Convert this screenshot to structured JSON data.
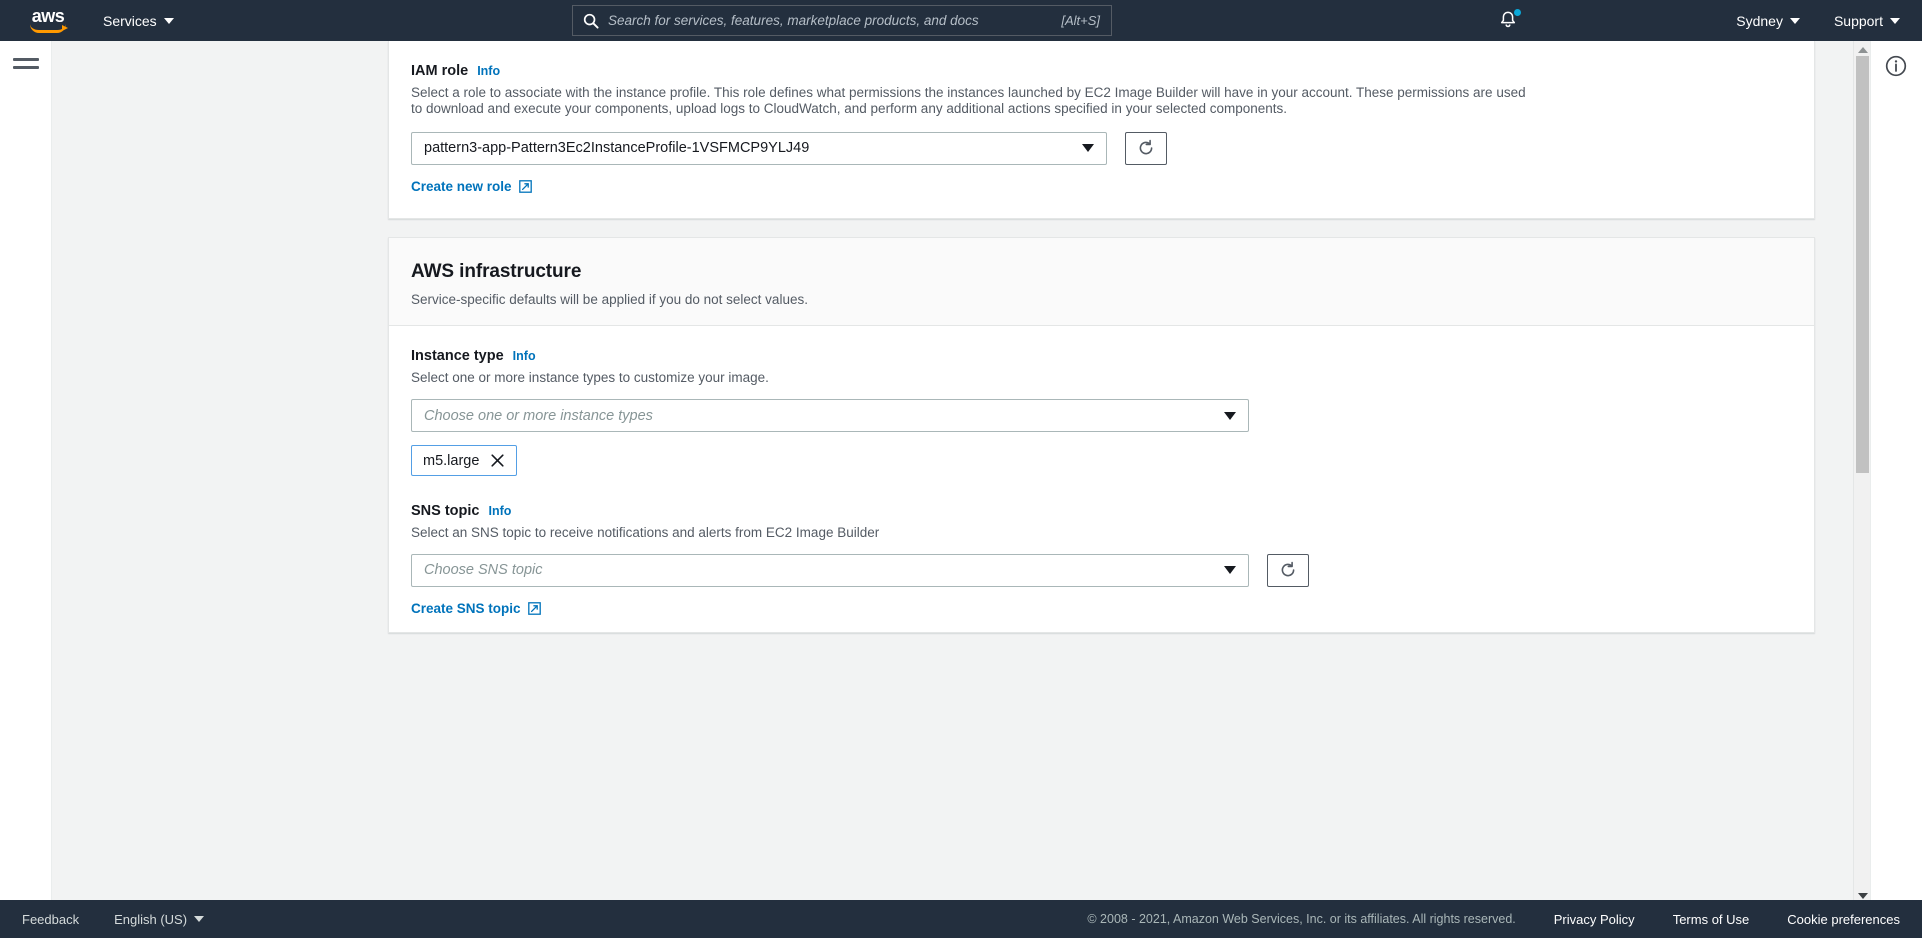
{
  "topnav": {
    "logo_text": "aws",
    "services_label": "Services",
    "search": {
      "placeholder": "Search for services, features, marketplace products, and docs",
      "value": "",
      "shortcut": "[Alt+S]"
    },
    "region_label": "Sydney",
    "support_label": "Support"
  },
  "cards": {
    "iam": {
      "label": "IAM role",
      "info_label": "Info",
      "description": "Select a role to associate with the instance profile. This role defines what permissions the instances launched by EC2 Image Builder will have in your account. These permissions are used to download and execute your components, upload logs to CloudWatch, and perform any additional actions specified in your selected components.",
      "selected_role": "pattern3-app-Pattern3Ec2InstanceProfile-1VSFMCP9YLJ49",
      "create_link": "Create new role"
    },
    "infrastructure": {
      "title": "AWS infrastructure",
      "subtitle": "Service-specific defaults will be applied if you do not select values.",
      "instance_type": {
        "label": "Instance type",
        "info_label": "Info",
        "description": "Select one or more instance types to customize your image.",
        "placeholder": "Choose one or more instance types",
        "value": "",
        "selected_tokens": [
          "m5.large"
        ]
      },
      "sns_topic": {
        "label": "SNS topic",
        "info_label": "Info",
        "description": "Select an SNS topic to receive notifications and alerts from EC2 Image Builder",
        "placeholder": "Choose SNS topic",
        "value": "",
        "create_link": "Create SNS topic"
      }
    }
  },
  "footer": {
    "feedback_label": "Feedback",
    "language_label": "English (US)",
    "copyright": "© 2008 - 2021, Amazon Web Services, Inc. or its affiliates. All rights reserved.",
    "links": [
      "Privacy Policy",
      "Terms of Use",
      "Cookie preferences"
    ]
  },
  "colors": {
    "nav_background": "#232f3e",
    "accent_orange": "#ff9900",
    "link_blue": "#0073bb",
    "token_border": "#539fe5",
    "page_background": "#f2f3f3",
    "notification_dot": "#0ba8d8"
  }
}
